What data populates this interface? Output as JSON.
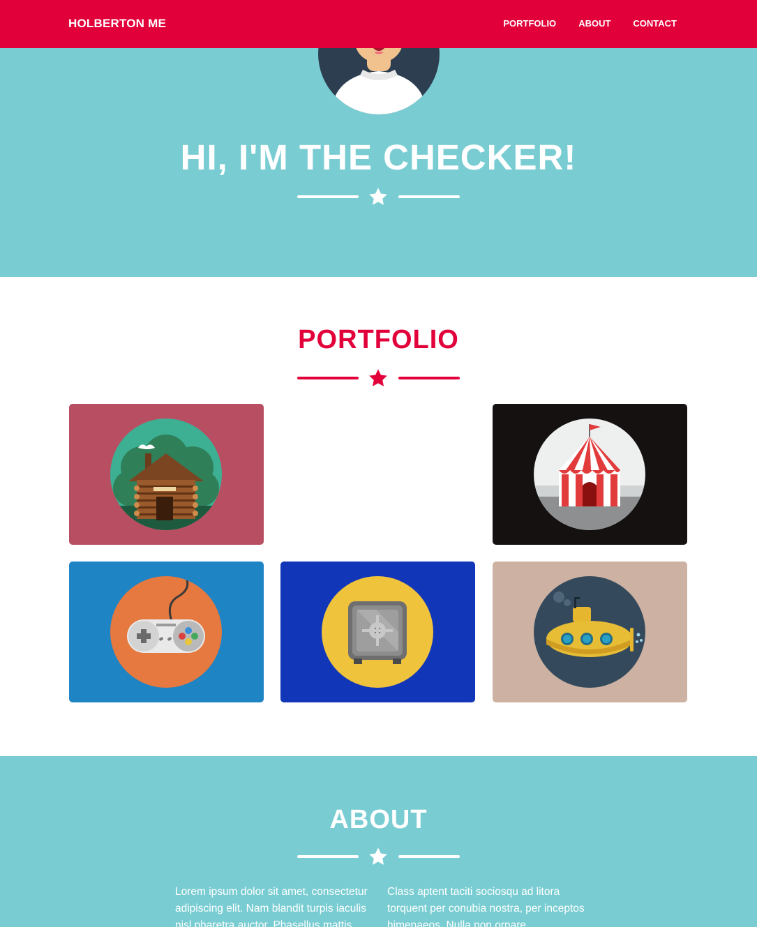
{
  "navbar": {
    "brand": "HOLBERTON ME",
    "links": [
      "PORTFOLIO",
      "ABOUT",
      "CONTACT"
    ]
  },
  "hero": {
    "title": "HI, I'M THE CHECKER!"
  },
  "portfolio": {
    "title": "PORTFOLIO",
    "items": [
      {
        "icon": "cabin-icon",
        "bg": "#b84e62"
      },
      {
        "icon": "circus-tent-icon",
        "bg": "#141110"
      },
      {
        "icon": "game-controller-icon",
        "bg": "#1f84c4"
      },
      {
        "icon": "safe-icon",
        "bg": "#1136b8"
      },
      {
        "icon": "submarine-icon",
        "bg": "#cdb2a3"
      }
    ]
  },
  "about": {
    "title": "ABOUT",
    "col1": "Lorem ipsum dolor sit amet, consectetur adipiscing elit. Nam blandit turpis iaculis nisl pharetra auctor. Phasellus mattis",
    "col2": "Class aptent taciti sociosqu ad litora torquent per conubia nostra, per inceptos himenaeos. Nulla non ornare"
  },
  "colors": {
    "primary": "#e2003a",
    "teal": "#79cdd2",
    "white": "#ffffff"
  }
}
